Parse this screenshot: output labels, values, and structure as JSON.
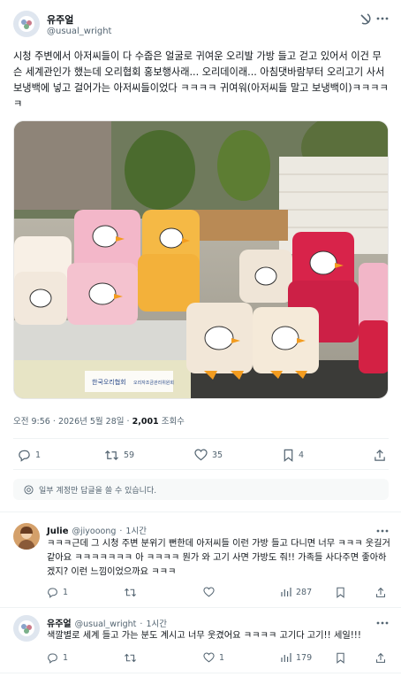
{
  "main_post": {
    "author": {
      "name": "유주얼",
      "handle": "@usual_wright"
    },
    "text": "시청 주변에서 아저씨들이 다 수줍은 얼굴로 귀여운 오리발 가방 들고 걷고 있어서 이건 무슨 세계관인가 했는데 오리협회 홍보행사래... 오리데이래... 아침댓바람부터 오리고기 사서 보냉백에 넣고 걸어가는 아저씨들이었다 ㅋㅋㅋㅋ 귀여워(아저씨들 말고 보냉백이)ㅋㅋㅋㅋㅋ",
    "image": {
      "banner_text": "한국오리협회",
      "banner_text_2": "오리자조금관리위원회"
    },
    "time": "오전 9:56",
    "date": "2026년 5월 28일",
    "views_count": "2,001",
    "views_label": "조회수",
    "stats": {
      "replies": "1",
      "reposts": "59",
      "likes": "35",
      "bookmarks": "4"
    }
  },
  "reply_notice": "일부 계정만 답글을 쓸 수 있습니다.",
  "replies": [
    {
      "name": "Julie",
      "handle": "@jiyooong",
      "time": "1시간",
      "text": "ㅋㅋㅋ근데 그 시청 주변 분위기 뻔한데 아저씨들 이런 가방 들고 다니면 너무 ㅋㅋㅋ 웃길거 같아요 ㅋㅋㅋㅋㅋㅋㅋ 아 ㅋㅋㅋㅋ 뭔가 와 고기 사면 가방도 줘!! 가족들 사다주면 좋아하겠지? 이런 느낌이었으까요 ㅋㅋㅋ",
      "stats": {
        "replies": "1",
        "reposts": "",
        "likes": "",
        "views": "287"
      }
    },
    {
      "name": "유주얼",
      "handle": "@usual_wright",
      "time": "1시간",
      "text": "색깔별로 세계 들고 가는 분도 계시고 너무 웃겼어요 ㅋㅋㅋㅋ 고기다 고기!! 세일!!!",
      "stats": {
        "replies": "1",
        "reposts": "",
        "likes": "1",
        "views": "179"
      }
    }
  ],
  "separator": "·",
  "icons": {
    "grok": "grok-icon",
    "more": "more-icon",
    "reply": "reply-icon",
    "repost": "repost-icon",
    "like": "like-icon",
    "bookmark": "bookmark-icon",
    "share": "share-icon",
    "views": "views-icon",
    "mention": "mention-icon"
  },
  "colors": {
    "text": "#0f1419",
    "secondary": "#536471",
    "divider": "#eff3f4",
    "notice_bg": "#f7f9f9"
  }
}
